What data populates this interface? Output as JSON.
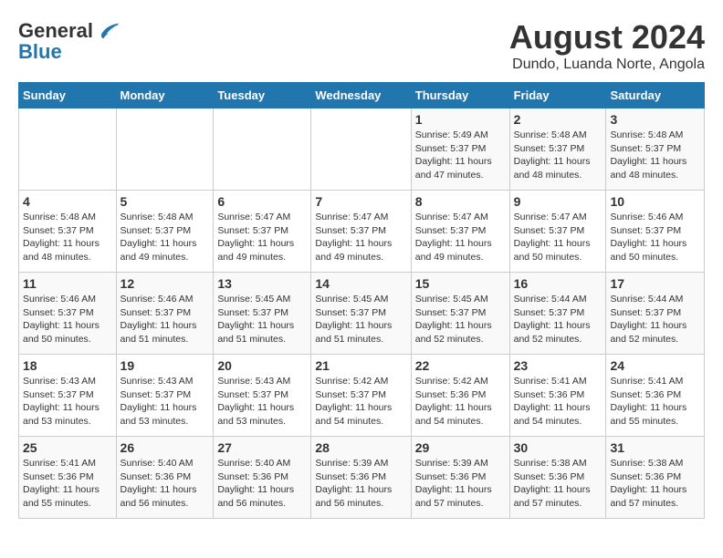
{
  "logo": {
    "general": "General",
    "blue": "Blue"
  },
  "header": {
    "title": "August 2024",
    "subtitle": "Dundo, Luanda Norte, Angola"
  },
  "days_of_week": [
    "Sunday",
    "Monday",
    "Tuesday",
    "Wednesday",
    "Thursday",
    "Friday",
    "Saturday"
  ],
  "weeks": [
    [
      {
        "day": "",
        "info": ""
      },
      {
        "day": "",
        "info": ""
      },
      {
        "day": "",
        "info": ""
      },
      {
        "day": "",
        "info": ""
      },
      {
        "day": "1",
        "info": "Sunrise: 5:49 AM\nSunset: 5:37 PM\nDaylight: 11 hours and 47 minutes."
      },
      {
        "day": "2",
        "info": "Sunrise: 5:48 AM\nSunset: 5:37 PM\nDaylight: 11 hours and 48 minutes."
      },
      {
        "day": "3",
        "info": "Sunrise: 5:48 AM\nSunset: 5:37 PM\nDaylight: 11 hours and 48 minutes."
      }
    ],
    [
      {
        "day": "4",
        "info": "Sunrise: 5:48 AM\nSunset: 5:37 PM\nDaylight: 11 hours and 48 minutes."
      },
      {
        "day": "5",
        "info": "Sunrise: 5:48 AM\nSunset: 5:37 PM\nDaylight: 11 hours and 49 minutes."
      },
      {
        "day": "6",
        "info": "Sunrise: 5:47 AM\nSunset: 5:37 PM\nDaylight: 11 hours and 49 minutes."
      },
      {
        "day": "7",
        "info": "Sunrise: 5:47 AM\nSunset: 5:37 PM\nDaylight: 11 hours and 49 minutes."
      },
      {
        "day": "8",
        "info": "Sunrise: 5:47 AM\nSunset: 5:37 PM\nDaylight: 11 hours and 49 minutes."
      },
      {
        "day": "9",
        "info": "Sunrise: 5:47 AM\nSunset: 5:37 PM\nDaylight: 11 hours and 50 minutes."
      },
      {
        "day": "10",
        "info": "Sunrise: 5:46 AM\nSunset: 5:37 PM\nDaylight: 11 hours and 50 minutes."
      }
    ],
    [
      {
        "day": "11",
        "info": "Sunrise: 5:46 AM\nSunset: 5:37 PM\nDaylight: 11 hours and 50 minutes."
      },
      {
        "day": "12",
        "info": "Sunrise: 5:46 AM\nSunset: 5:37 PM\nDaylight: 11 hours and 51 minutes."
      },
      {
        "day": "13",
        "info": "Sunrise: 5:45 AM\nSunset: 5:37 PM\nDaylight: 11 hours and 51 minutes."
      },
      {
        "day": "14",
        "info": "Sunrise: 5:45 AM\nSunset: 5:37 PM\nDaylight: 11 hours and 51 minutes."
      },
      {
        "day": "15",
        "info": "Sunrise: 5:45 AM\nSunset: 5:37 PM\nDaylight: 11 hours and 52 minutes."
      },
      {
        "day": "16",
        "info": "Sunrise: 5:44 AM\nSunset: 5:37 PM\nDaylight: 11 hours and 52 minutes."
      },
      {
        "day": "17",
        "info": "Sunrise: 5:44 AM\nSunset: 5:37 PM\nDaylight: 11 hours and 52 minutes."
      }
    ],
    [
      {
        "day": "18",
        "info": "Sunrise: 5:43 AM\nSunset: 5:37 PM\nDaylight: 11 hours and 53 minutes."
      },
      {
        "day": "19",
        "info": "Sunrise: 5:43 AM\nSunset: 5:37 PM\nDaylight: 11 hours and 53 minutes."
      },
      {
        "day": "20",
        "info": "Sunrise: 5:43 AM\nSunset: 5:37 PM\nDaylight: 11 hours and 53 minutes."
      },
      {
        "day": "21",
        "info": "Sunrise: 5:42 AM\nSunset: 5:37 PM\nDaylight: 11 hours and 54 minutes."
      },
      {
        "day": "22",
        "info": "Sunrise: 5:42 AM\nSunset: 5:36 PM\nDaylight: 11 hours and 54 minutes."
      },
      {
        "day": "23",
        "info": "Sunrise: 5:41 AM\nSunset: 5:36 PM\nDaylight: 11 hours and 54 minutes."
      },
      {
        "day": "24",
        "info": "Sunrise: 5:41 AM\nSunset: 5:36 PM\nDaylight: 11 hours and 55 minutes."
      }
    ],
    [
      {
        "day": "25",
        "info": "Sunrise: 5:41 AM\nSunset: 5:36 PM\nDaylight: 11 hours and 55 minutes."
      },
      {
        "day": "26",
        "info": "Sunrise: 5:40 AM\nSunset: 5:36 PM\nDaylight: 11 hours and 56 minutes."
      },
      {
        "day": "27",
        "info": "Sunrise: 5:40 AM\nSunset: 5:36 PM\nDaylight: 11 hours and 56 minutes."
      },
      {
        "day": "28",
        "info": "Sunrise: 5:39 AM\nSunset: 5:36 PM\nDaylight: 11 hours and 56 minutes."
      },
      {
        "day": "29",
        "info": "Sunrise: 5:39 AM\nSunset: 5:36 PM\nDaylight: 11 hours and 57 minutes."
      },
      {
        "day": "30",
        "info": "Sunrise: 5:38 AM\nSunset: 5:36 PM\nDaylight: 11 hours and 57 minutes."
      },
      {
        "day": "31",
        "info": "Sunrise: 5:38 AM\nSunset: 5:36 PM\nDaylight: 11 hours and 57 minutes."
      }
    ]
  ]
}
